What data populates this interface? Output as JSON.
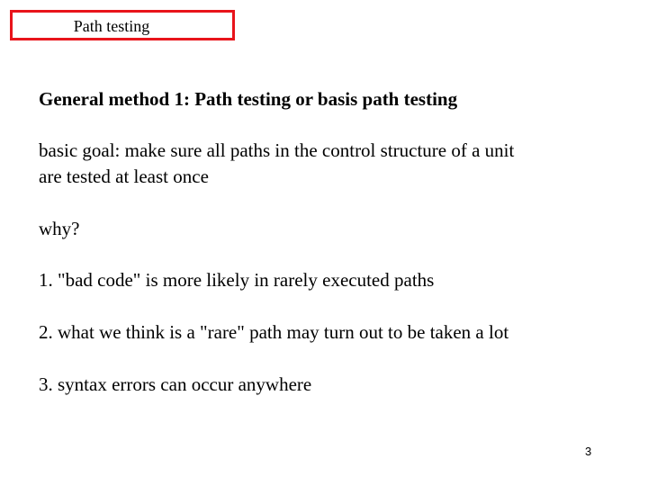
{
  "slide": {
    "title": "Path testing",
    "title_border_color": "#e8141b",
    "heading": "General method 1:  Path testing or basis path testing",
    "goal_lines": [
      "basic goal: make sure all paths in the control structure of a unit",
      "are tested at least once"
    ],
    "why": "why?",
    "reasons": [
      "1. \"bad code\" is more likely in rarely executed paths",
      "2.  what we think is a \"rare\" path may turn out to be taken a lot",
      "3.  syntax errors can occur anywhere"
    ],
    "page_number": "3"
  }
}
